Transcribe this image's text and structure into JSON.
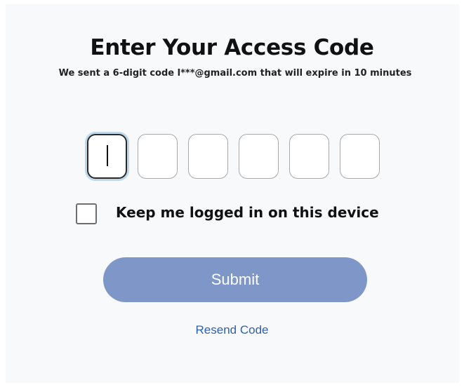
{
  "heading": {
    "title": "Enter Your Access Code",
    "subtitle": "We sent a 6-digit code l***@gmail.com that will expire in 10 minutes"
  },
  "code_input": {
    "digits": [
      "",
      "",
      "",
      "",
      "",
      ""
    ],
    "focused_index": 0
  },
  "remember": {
    "label": "Keep me logged in on this device",
    "checked": false
  },
  "actions": {
    "submit_label": "Submit",
    "resend_label": "Resend Code"
  },
  "colors": {
    "submit_bg": "#7f97c8",
    "link": "#2f5fad",
    "focus_ring": "#bfd7ea"
  }
}
